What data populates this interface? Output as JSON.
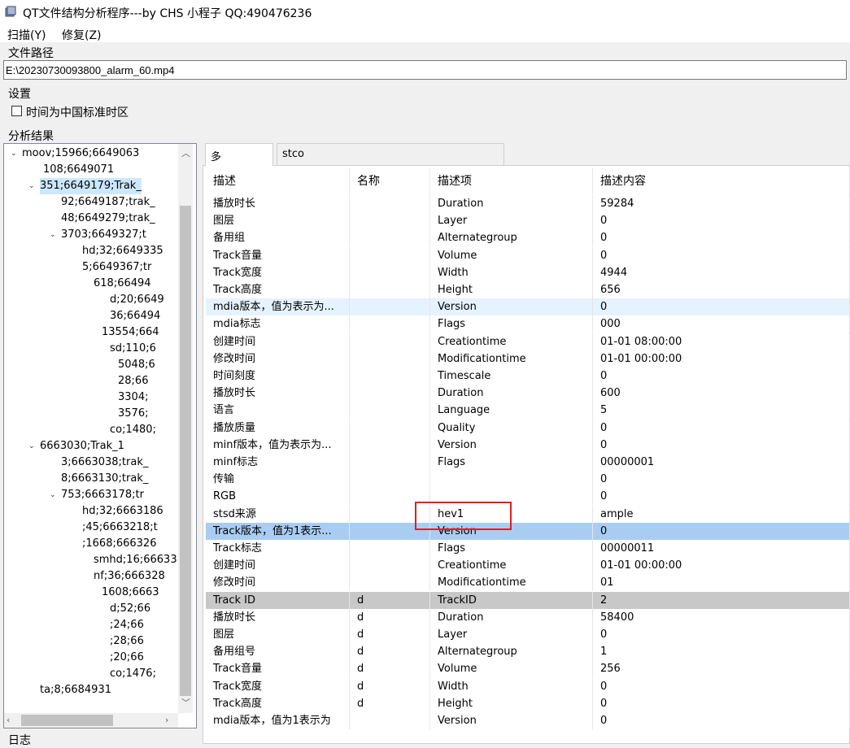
{
  "window": {
    "title": "QT文件结构分析程序---by CHS 小程子 QQ:490476236"
  },
  "menu": {
    "scan": "扫描(Y)",
    "repair": "修复(Z)"
  },
  "file_path": {
    "label": "文件路径",
    "value": "E:\\20230730093800_alarm_60.mp4"
  },
  "settings": {
    "label": "设置",
    "utc_checkbox_label": "时间为中国标准时区",
    "utc_checked": false
  },
  "results": {
    "label": "分析结果"
  },
  "log": {
    "label": "日志"
  },
  "tree": [
    {
      "text": "moov;15966;6649063",
      "twisty": "⌄",
      "sel": false
    },
    {
      "text": "108;6649071",
      "twisty": "",
      "sel": false
    },
    {
      "text": "351;6649179;Trak_",
      "twisty": "⌄",
      "sel": true
    },
    {
      "text": "92;6649187;trak_",
      "twisty": "",
      "sel": false
    },
    {
      "text": "48;6649279;trak_",
      "twisty": "",
      "sel": false
    },
    {
      "text": "3703;6649327;t",
      "twisty": "⌄",
      "sel": false
    },
    {
      "text": "hd;32;6649335",
      "twisty": "",
      "sel": false
    },
    {
      "text": "5;6649367;tr",
      "twisty": "",
      "sel": false
    },
    {
      "text": "618;66494",
      "twisty": "",
      "sel": false
    },
    {
      "text": "d;20;6649",
      "twisty": "",
      "sel": false
    },
    {
      "text": "36;66494",
      "twisty": "",
      "sel": false
    },
    {
      "text": "13554;664",
      "twisty": "",
      "sel": false
    },
    {
      "text": "sd;110;6",
      "twisty": "",
      "sel": false
    },
    {
      "text": "5048;6",
      "twisty": "",
      "sel": false
    },
    {
      "text": "28;66",
      "twisty": "",
      "sel": false
    },
    {
      "text": "3304;",
      "twisty": "",
      "sel": false
    },
    {
      "text": "3576;",
      "twisty": "",
      "sel": false
    },
    {
      "text": "co;1480;",
      "twisty": "",
      "sel": false
    },
    {
      "text": "6663030;Trak_1",
      "twisty": "⌄",
      "sel": false
    },
    {
      "text": "3;6663038;trak_",
      "twisty": "",
      "sel": false
    },
    {
      "text": "8;6663130;trak_",
      "twisty": "",
      "sel": false
    },
    {
      "text": "753;6663178;tr",
      "twisty": "⌄",
      "sel": false
    },
    {
      "text": "hd;32;6663186",
      "twisty": "",
      "sel": false
    },
    {
      "text": ";45;6663218;t",
      "twisty": "",
      "sel": false
    },
    {
      "text": ";1668;666326",
      "twisty": "",
      "sel": false
    },
    {
      "text": "smhd;16;66633",
      "twisty": "",
      "sel": false
    },
    {
      "text": "nf;36;666328",
      "twisty": "",
      "sel": false
    },
    {
      "text": "1608;6663",
      "twisty": "",
      "sel": false
    },
    {
      "text": "d;52;66",
      "twisty": "",
      "sel": false
    },
    {
      "text": ";24;66",
      "twisty": "",
      "sel": false
    },
    {
      "text": ";28;66",
      "twisty": "",
      "sel": false
    },
    {
      "text": ";20;66",
      "twisty": "",
      "sel": false
    },
    {
      "text": "co;1476;",
      "twisty": "",
      "sel": false
    },
    {
      "text": "ta;8;6684931",
      "twisty": "",
      "sel": false
    }
  ],
  "tabs": [
    {
      "label": "多",
      "active": true
    },
    {
      "label": "stco",
      "active": false
    }
  ],
  "table": {
    "headers": [
      "描述",
      "名称",
      "描述项",
      "描述内容"
    ],
    "rows": [
      {
        "c": [
          "播放时长",
          "",
          "Duration",
          "59284"
        ],
        "s": ""
      },
      {
        "c": [
          "图层",
          "",
          "Layer",
          "0"
        ],
        "s": ""
      },
      {
        "c": [
          "备用组",
          "",
          "Alternategroup",
          "0"
        ],
        "s": ""
      },
      {
        "c": [
          "Track音量",
          "",
          "Volume",
          "0"
        ],
        "s": ""
      },
      {
        "c": [
          "Track宽度",
          "",
          "Width",
          "4944"
        ],
        "s": ""
      },
      {
        "c": [
          "Track高度",
          "",
          "Height",
          "656"
        ],
        "s": ""
      },
      {
        "c": [
          "mdia版本，值为表示为...",
          "",
          "Version",
          "0"
        ],
        "s": "blue"
      },
      {
        "c": [
          "mdia标志",
          "",
          "Flags",
          "000"
        ],
        "s": ""
      },
      {
        "c": [
          "创建时间",
          "",
          "Creationtime",
          "01-01 08:00:00"
        ],
        "s": ""
      },
      {
        "c": [
          "修改时间",
          "",
          "Modificationtime",
          "01-01 00:00:00"
        ],
        "s": ""
      },
      {
        "c": [
          "时间刻度",
          "",
          "Timescale",
          "0"
        ],
        "s": ""
      },
      {
        "c": [
          "播放时长",
          "",
          "Duration",
          "600"
        ],
        "s": ""
      },
      {
        "c": [
          "语言",
          "",
          "Language",
          "5"
        ],
        "s": ""
      },
      {
        "c": [
          "播放质量",
          "",
          "Quality",
          "0"
        ],
        "s": ""
      },
      {
        "c": [
          "minf版本，值为表示为...",
          "",
          "Version",
          "0"
        ],
        "s": ""
      },
      {
        "c": [
          "minf标志",
          "",
          "Flags",
          "00000001"
        ],
        "s": ""
      },
      {
        "c": [
          "传输",
          "",
          "",
          "0"
        ],
        "s": ""
      },
      {
        "c": [
          "RGB",
          "",
          "",
          "0"
        ],
        "s": ""
      },
      {
        "c": [
          "stsd来源",
          "",
          "hev1",
          "ample"
        ],
        "s": ""
      },
      {
        "c": [
          "Track版本，值为1表示...",
          "",
          "Version",
          "0"
        ],
        "s": "sel"
      },
      {
        "c": [
          "Track标志",
          "",
          "Flags",
          "00000011"
        ],
        "s": ""
      },
      {
        "c": [
          "创建时间",
          "",
          "Creationtime",
          "01-01 00:00:00"
        ],
        "s": ""
      },
      {
        "c": [
          "修改时间",
          "",
          "Modificationtime",
          "01"
        ],
        "s": ""
      },
      {
        "c": [
          "Track ID",
          "d",
          "TrackID",
          "2"
        ],
        "s": "gray"
      },
      {
        "c": [
          "播放时长",
          "d",
          "Duration",
          "58400"
        ],
        "s": ""
      },
      {
        "c": [
          "图层",
          "d",
          "Layer",
          "0"
        ],
        "s": ""
      },
      {
        "c": [
          "备用组号",
          "d",
          "Alternategroup",
          "1"
        ],
        "s": ""
      },
      {
        "c": [
          "Track音量",
          "d",
          "Volume",
          "256"
        ],
        "s": ""
      },
      {
        "c": [
          "Track宽度",
          "d",
          "Width",
          "0"
        ],
        "s": ""
      },
      {
        "c": [
          "Track高度",
          "d",
          "Height",
          "0"
        ],
        "s": ""
      },
      {
        "c": [
          "mdia版本，值为1表示为",
          "",
          "Version",
          "0"
        ],
        "s": ""
      }
    ]
  }
}
